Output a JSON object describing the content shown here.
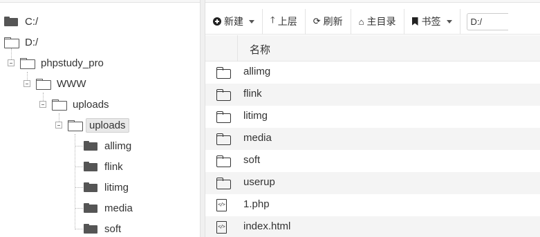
{
  "tree": {
    "drives": [
      {
        "label": "C:/",
        "icon": "folder-closed-icon"
      },
      {
        "label": "D:/",
        "icon": "folder-open-icon"
      }
    ],
    "nodes": [
      {
        "label": "phpstudy_pro",
        "icon": "folder-open-icon"
      },
      {
        "label": "WWW",
        "icon": "folder-open-icon"
      },
      {
        "label": "uploads",
        "icon": "folder-open-icon"
      },
      {
        "label": "uploads",
        "icon": "folder-open-icon",
        "selected": true
      }
    ],
    "children": [
      {
        "label": "allimg",
        "icon": "folder-closed-icon"
      },
      {
        "label": "flink",
        "icon": "folder-closed-icon"
      },
      {
        "label": "litimg",
        "icon": "folder-closed-icon"
      },
      {
        "label": "media",
        "icon": "folder-closed-icon"
      },
      {
        "label": "soft",
        "icon": "folder-closed-icon"
      }
    ]
  },
  "toolbar": {
    "new_label": "新建",
    "up_label": "上层",
    "refresh_label": "刷新",
    "home_label": "主目录",
    "bookmark_label": "书签",
    "path_value": "D:/"
  },
  "file_list": {
    "name_header": "名称",
    "rows": [
      {
        "name": "allimg",
        "type": "folder"
      },
      {
        "name": "flink",
        "type": "folder"
      },
      {
        "name": "litimg",
        "type": "folder"
      },
      {
        "name": "media",
        "type": "folder"
      },
      {
        "name": "soft",
        "type": "folder"
      },
      {
        "name": "userup",
        "type": "folder"
      },
      {
        "name": "1.php",
        "type": "code"
      },
      {
        "name": "index.html",
        "type": "code"
      }
    ]
  },
  "colors": {
    "row_alt": "#f4f4f4",
    "header_bg": "#f5f5f5",
    "icon": "#333333",
    "tree_folder": "#555555"
  }
}
